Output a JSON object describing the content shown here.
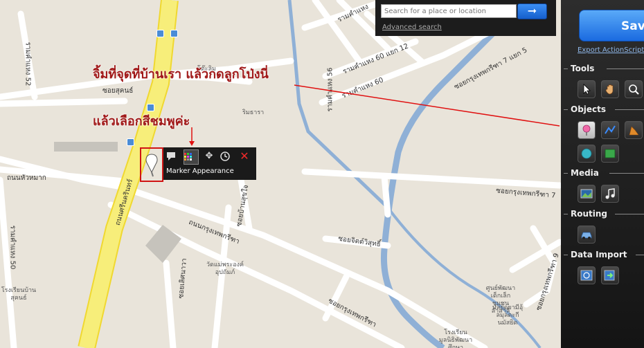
{
  "map": {
    "roads": [
      "รามคำแหง 60 แยก 12",
      "รามคำแหง 60",
      "ซอยสุคนธ์",
      "ถนนศรีนครินทร์",
      "ซอยกรุงเทพกรีฑา 7 แยก 5",
      "ถนนหัวหมาก",
      "ถนนกรุงเทพกรีฑา",
      "ซอยกรุงเทพกรีฑา 7",
      "ซอยบ้านสุขใจ",
      "ซอยจิตต์วิสุทธิ์",
      "ซอยเลิศนาวา",
      "ซอยกรุงเทพกรีฑา",
      "ซอยกรุงเทพกรีฑา 9",
      "รามคำแหง 52",
      "รามคำแหง 50",
      "รามคำแหง 56",
      "รามคำแหง"
    ],
    "pois": [
      "ริมธารา",
      "วัดแม่พระองค์อุปถัมภ์",
      "ศูนย์พัฒนาเด็กเล็กชุมชนลำสาลี",
      "มัสยิดยามีอุ้ลมุลตะกีนมัสยิด",
      "โรงเรียนมูลนิธิพัฒนาศึกษา",
      "โรงเรียนบ้านสุคนธ์",
      "โต๊ะลิม"
    ]
  },
  "annotations": {
    "line1": "จิ้มที่จุดที่บ้านเรา แล้วกดลูกโป่งนี่",
    "line2": "แล้วเลือกสีชมพูค่ะ"
  },
  "search": {
    "placeholder": "Search for a place or location",
    "button_icon": "arrow-right-icon",
    "advanced_label": "Advanced search"
  },
  "marker_toolbar": {
    "tooltip": "Marker Appearance",
    "buttons": [
      "comment-icon",
      "color-grid-icon",
      "move-icon",
      "clock-icon",
      "close-icon"
    ]
  },
  "panel": {
    "save_label": "Save",
    "export_label": "Export ActionScript",
    "sections": {
      "tools": "Tools",
      "objects": "Objects",
      "media": "Media",
      "routing": "Routing",
      "data_import": "Data Import"
    }
  },
  "colors": {
    "highway": "#f5e86a",
    "canal": "#8fb0d6",
    "annotation": "#a01818",
    "save_button": "#1a6ae0",
    "marker_box": "#d01414"
  }
}
